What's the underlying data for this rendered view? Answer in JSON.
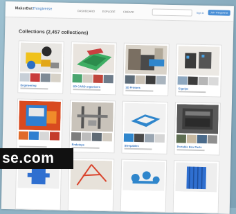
{
  "header": {
    "logo": "MakerBot",
    "logo_sub": "Thingiverse",
    "nav": [
      "DASHBOARD",
      "EXPLORE",
      "CREATE"
    ],
    "signin": "Sign In",
    "join": "Join Thingiverse"
  },
  "page": {
    "heading": "Collections (2,457 collections)"
  },
  "collections": [
    {
      "name": "Engineering"
    },
    {
      "name": "SD CARD organizers"
    },
    {
      "name": "3D Printers"
    },
    {
      "name": "Gigolps"
    },
    {
      "name": ""
    },
    {
      "name": "Endstops"
    },
    {
      "name": "Sleepables"
    },
    {
      "name": "Portable Box Parts"
    },
    {
      "name": ""
    },
    {
      "name": ""
    },
    {
      "name": ""
    },
    {
      "name": ""
    }
  ],
  "watermark": "se.com",
  "colors": {
    "accent": "#3a78c2",
    "join_button": "#4a8fd6",
    "backdrop": "#8fb2c4",
    "watermark_bg": "#111111"
  }
}
